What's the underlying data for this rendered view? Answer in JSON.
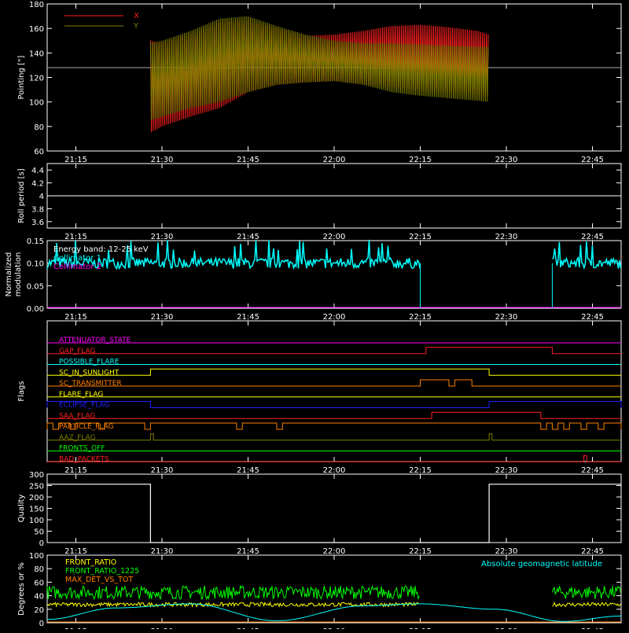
{
  "time_ticks": [
    "21:15",
    "21:30",
    "21:45",
    "22:00",
    "22:15",
    "22:30",
    "22:45"
  ],
  "chart_data": [
    {
      "type": "line",
      "panel": "pointing",
      "ylabel": "Pointing [\"]",
      "ylim": [
        60,
        180
      ],
      "yticks": [
        60,
        80,
        100,
        120,
        140,
        160,
        180
      ],
      "legend": {
        "placement": "top-left",
        "entries": [
          {
            "name": "X",
            "color": "#ff2020"
          },
          {
            "name": "Y",
            "color": "#808000"
          }
        ]
      },
      "reference_line": {
        "value": 128,
        "color": "#aaaaaa"
      },
      "x_start": "21:28",
      "x_end": "22:27",
      "series": [
        {
          "name": "X",
          "color": "#ff2020",
          "time": [
            "21:28",
            "21:30",
            "21:35",
            "21:40",
            "21:45",
            "21:50",
            "21:55",
            "22:00",
            "22:05",
            "22:10",
            "22:15",
            "22:20",
            "22:25",
            "22:27"
          ],
          "upper": [
            150,
            148,
            155,
            165,
            166,
            160,
            154,
            155,
            158,
            162,
            163,
            161,
            158,
            155
          ],
          "lower": [
            75,
            80,
            88,
            95,
            108,
            114,
            116,
            117,
            115,
            112,
            110,
            108,
            106,
            105
          ]
        },
        {
          "name": "Y",
          "color": "#808000",
          "time": [
            "21:28",
            "21:30",
            "21:35",
            "21:40",
            "21:45",
            "21:50",
            "21:55",
            "22:00",
            "22:05",
            "22:10",
            "22:15",
            "22:20",
            "22:25",
            "22:27"
          ],
          "upper": [
            148,
            150,
            158,
            168,
            170,
            162,
            155,
            150,
            148,
            148,
            147,
            146,
            145,
            145
          ],
          "lower": [
            85,
            88,
            95,
            100,
            108,
            114,
            116,
            117,
            114,
            108,
            105,
            103,
            101,
            100
          ]
        }
      ]
    },
    {
      "type": "line",
      "panel": "roll-period",
      "ylabel": "Roll period [s]",
      "ylim": [
        3.5,
        4.5
      ],
      "yticks": [
        3.6,
        3.8,
        4.0,
        4.2,
        4.4
      ],
      "series": [
        {
          "color": "#ffffff",
          "value": 4.0
        }
      ]
    },
    {
      "type": "line",
      "panel": "modulation",
      "ylabel": [
        "Normalized",
        "modulation"
      ],
      "ylim": [
        0,
        0.15
      ],
      "yticks": [
        "0.00",
        "0.05",
        "0.10",
        "0.15"
      ],
      "legend": {
        "placement": "top-left",
        "entries": [
          {
            "name": "Energy band: 12-25 keV",
            "color": "#ffffff"
          },
          {
            "name": "Collimator 1",
            "color": "#00ffff"
          },
          {
            "name": "Collimator 2",
            "color": "#ff00ff"
          }
        ]
      },
      "series": [
        {
          "name": "Collimator 1",
          "color": "#00ffff",
          "mean": 0.1,
          "spread": 0.012,
          "segments": [
            [
              "21:10",
              "22:15"
            ],
            [
              "22:38",
              "22:50"
            ]
          ],
          "dips": [
            "22:15",
            "22:38"
          ]
        },
        {
          "name": "Collimator 2",
          "color": "#ff00ff",
          "value": 0.0
        }
      ]
    },
    {
      "type": "line",
      "panel": "flags",
      "ylabel": "Flags",
      "series": [
        {
          "name": "ATTENUATOR_STATE",
          "color": "#ff00ff",
          "highs": []
        },
        {
          "name": "GAP_FLAG",
          "color": "#ff2020",
          "highs": [
            [
              "22:16",
              "22:38"
            ]
          ]
        },
        {
          "name": "POSSIBLE_FLARE",
          "color": "#00ffff",
          "highs": []
        },
        {
          "name": "SC_IN_SUNLIGHT",
          "color": "#ffff00",
          "highs": [
            [
              "21:28",
              "22:27"
            ]
          ]
        },
        {
          "name": "SC_TRANSMITTER",
          "color": "#ff8000",
          "highs": [
            [
              "22:15",
              "22:20"
            ],
            [
              "22:21",
              "22:24"
            ]
          ]
        },
        {
          "name": "FLARE_FLAG",
          "color": "#ffff00",
          "highs": []
        },
        {
          "name": "ECLIPSE_FLAG",
          "color": "#2020ff",
          "highs": [
            [
              "21:10",
              "21:28"
            ],
            [
              "22:27",
              "22:50"
            ]
          ]
        },
        {
          "name": "SAA_FLAG",
          "color": "#ff2020",
          "highs": [
            [
              "22:17",
              "22:36"
            ]
          ]
        },
        {
          "name": "PARTICLE_FLAG",
          "color": "#ff8000",
          "highs": [
            [
              "21:10",
              "21:11"
            ],
            [
              "21:12",
              "21:14"
            ],
            [
              "21:15",
              "21:19"
            ],
            [
              "21:20",
              "21:27"
            ],
            [
              "21:28",
              "21:43"
            ],
            [
              "21:44",
              "21:50"
            ],
            [
              "21:51",
              "22:36"
            ],
            [
              "22:37",
              "22:38"
            ],
            [
              "22:39",
              "22:40"
            ],
            [
              "22:41",
              "22:43"
            ],
            [
              "22:44",
              "22:46"
            ],
            [
              "22:47",
              "22:50"
            ]
          ]
        },
        {
          "name": "AAZ_FLAG",
          "color": "#808000",
          "highs": [
            [
              "21:28",
              "21:28.5"
            ],
            [
              "22:27",
              "22:27.5"
            ]
          ]
        },
        {
          "name": "FRONTS_OFF",
          "color": "#00ff00",
          "highs": []
        },
        {
          "name": "BAD_PACKETS",
          "color": "#ff2020",
          "highs": [
            [
              "22:43.5",
              "22:44"
            ]
          ]
        }
      ]
    },
    {
      "type": "line",
      "panel": "quality",
      "ylabel": "Quality",
      "ylim": [
        0,
        300
      ],
      "yticks": [
        0,
        50,
        100,
        150,
        200,
        250,
        300
      ],
      "series": [
        {
          "color": "#ffffff",
          "time": [
            "21:10",
            "21:28",
            "21:28",
            "22:27",
            "22:27",
            "22:50"
          ],
          "values": [
            256,
            256,
            0,
            0,
            256,
            256
          ]
        }
      ]
    },
    {
      "type": "line",
      "panel": "fronts",
      "ylabel": "Degrees or %",
      "ylim": [
        0,
        100
      ],
      "yticks": [
        0,
        20,
        40,
        60,
        80,
        100
      ],
      "legend": {
        "placement": "top-left",
        "entries": [
          {
            "name": "FRONT_RATIO",
            "color": "#ffff00"
          },
          {
            "name": "FRONT_RATIO_1225",
            "color": "#00ff00"
          },
          {
            "name": "MAX_DET_VS_TOT",
            "color": "#ff8000"
          }
        ]
      },
      "annotation": {
        "text": "Absolute geomagnetic latitude",
        "color": "#00ffff"
      },
      "series": [
        {
          "name": "FRONT_RATIO_1225",
          "color": "#00ff00",
          "mean": 45,
          "spread": 10,
          "segments": [
            [
              "21:10",
              "22:15"
            ],
            [
              "22:38",
              "22:50"
            ]
          ]
        },
        {
          "name": "FRONT_RATIO",
          "color": "#ffff00",
          "mean": 27,
          "spread": 3,
          "segments": [
            [
              "21:10",
              "22:15"
            ],
            [
              "22:38",
              "22:50"
            ]
          ]
        },
        {
          "name": "MAX_DET_VS_TOT",
          "color": "#ff8000",
          "value": 0
        },
        {
          "name": "Absolute geomagnetic latitude",
          "color": "#00ffff",
          "time": [
            "21:10",
            "21:22",
            "21:35",
            "21:50",
            "22:05",
            "22:15",
            "22:28",
            "22:40",
            "22:50"
          ],
          "values": [
            5,
            22,
            28,
            3,
            25,
            28,
            20,
            2,
            10
          ]
        }
      ]
    }
  ]
}
